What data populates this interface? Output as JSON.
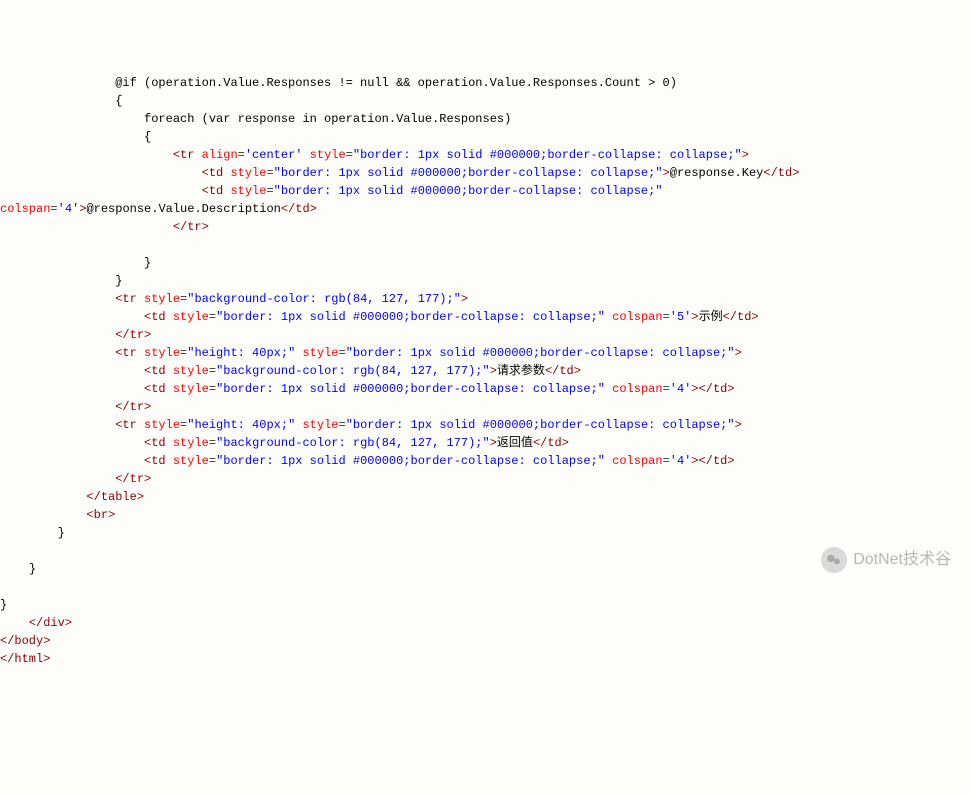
{
  "lines": [
    {
      "indent": "                ",
      "parts": [
        {
          "t": "@if (operation.Value.Responses != null && operation.Value.Responses.Count > 0)",
          "c": "razor"
        }
      ]
    },
    {
      "indent": "                ",
      "parts": [
        {
          "t": "{",
          "c": "razor"
        }
      ]
    },
    {
      "indent": "                    ",
      "parts": [
        {
          "t": "foreach (var response in operation.Value.Responses)",
          "c": "razor"
        }
      ]
    },
    {
      "indent": "                    ",
      "parts": [
        {
          "t": "{",
          "c": "razor"
        }
      ]
    },
    {
      "indent": "                        ",
      "parts": [
        {
          "t": "<",
          "c": "tag"
        },
        {
          "t": "tr",
          "c": "tag"
        },
        {
          "t": " ",
          "c": ""
        },
        {
          "t": "align",
          "c": "attr-name"
        },
        {
          "t": "=",
          "c": ""
        },
        {
          "t": "'center'",
          "c": "attr-value"
        },
        {
          "t": " ",
          "c": ""
        },
        {
          "t": "style",
          "c": "attr-name"
        },
        {
          "t": "=",
          "c": ""
        },
        {
          "t": "\"border: 1px solid #000000;border-collapse: collapse;\"",
          "c": "attr-value"
        },
        {
          "t": ">",
          "c": "tag"
        }
      ]
    },
    {
      "indent": "                            ",
      "parts": [
        {
          "t": "<",
          "c": "tag"
        },
        {
          "t": "td",
          "c": "tag"
        },
        {
          "t": " ",
          "c": ""
        },
        {
          "t": "style",
          "c": "attr-name"
        },
        {
          "t": "=",
          "c": ""
        },
        {
          "t": "\"border: 1px solid #000000;border-collapse: collapse;\"",
          "c": "attr-value"
        },
        {
          "t": ">",
          "c": "tag"
        },
        {
          "t": "@response.Key",
          "c": "razor"
        },
        {
          "t": "</",
          "c": "tag"
        },
        {
          "t": "td",
          "c": "tag"
        },
        {
          "t": ">",
          "c": "tag"
        }
      ]
    },
    {
      "indent": "                            ",
      "parts": [
        {
          "t": "<",
          "c": "tag"
        },
        {
          "t": "td",
          "c": "tag"
        },
        {
          "t": " ",
          "c": ""
        },
        {
          "t": "style",
          "c": "attr-name"
        },
        {
          "t": "=",
          "c": ""
        },
        {
          "t": "\"border: 1px solid #000000;border-collapse: collapse;\"",
          "c": "attr-value"
        },
        {
          "t": " ",
          "c": ""
        }
      ]
    },
    {
      "indent": "",
      "parts": [
        {
          "t": "colspan",
          "c": "attr-name"
        },
        {
          "t": "=",
          "c": ""
        },
        {
          "t": "'4'",
          "c": "attr-value"
        },
        {
          "t": ">",
          "c": "tag"
        },
        {
          "t": "@response.Value.Description",
          "c": "razor"
        },
        {
          "t": "</",
          "c": "tag"
        },
        {
          "t": "td",
          "c": "tag"
        },
        {
          "t": ">",
          "c": "tag"
        }
      ]
    },
    {
      "indent": "                        ",
      "parts": [
        {
          "t": "</",
          "c": "tag"
        },
        {
          "t": "tr",
          "c": "tag"
        },
        {
          "t": ">",
          "c": "tag"
        }
      ]
    },
    {
      "indent": "",
      "parts": []
    },
    {
      "indent": "                    ",
      "parts": [
        {
          "t": "}",
          "c": "razor"
        }
      ]
    },
    {
      "indent": "                ",
      "parts": [
        {
          "t": "}",
          "c": "razor"
        }
      ]
    },
    {
      "indent": "                ",
      "parts": [
        {
          "t": "<",
          "c": "tag"
        },
        {
          "t": "tr",
          "c": "tag"
        },
        {
          "t": " ",
          "c": ""
        },
        {
          "t": "style",
          "c": "attr-name"
        },
        {
          "t": "=",
          "c": ""
        },
        {
          "t": "\"background-color: rgb(84, 127, 177);\"",
          "c": "attr-value"
        },
        {
          "t": ">",
          "c": "tag"
        }
      ]
    },
    {
      "indent": "                    ",
      "parts": [
        {
          "t": "<",
          "c": "tag"
        },
        {
          "t": "td",
          "c": "tag"
        },
        {
          "t": " ",
          "c": ""
        },
        {
          "t": "style",
          "c": "attr-name"
        },
        {
          "t": "=",
          "c": ""
        },
        {
          "t": "\"border: 1px solid #000000;border-collapse: collapse;\"",
          "c": "attr-value"
        },
        {
          "t": " ",
          "c": ""
        },
        {
          "t": "colspan",
          "c": "attr-name"
        },
        {
          "t": "=",
          "c": ""
        },
        {
          "t": "'5'",
          "c": "attr-value"
        },
        {
          "t": ">",
          "c": "tag"
        },
        {
          "t": "示例",
          "c": "text-content"
        },
        {
          "t": "</",
          "c": "tag"
        },
        {
          "t": "td",
          "c": "tag"
        },
        {
          "t": ">",
          "c": "tag"
        }
      ]
    },
    {
      "indent": "                ",
      "parts": [
        {
          "t": "</",
          "c": "tag"
        },
        {
          "t": "tr",
          "c": "tag"
        },
        {
          "t": ">",
          "c": "tag"
        }
      ]
    },
    {
      "indent": "                ",
      "parts": [
        {
          "t": "<",
          "c": "tag"
        },
        {
          "t": "tr",
          "c": "tag"
        },
        {
          "t": " ",
          "c": ""
        },
        {
          "t": "style",
          "c": "attr-name"
        },
        {
          "t": "=",
          "c": ""
        },
        {
          "t": "\"height: 40px;\"",
          "c": "attr-value"
        },
        {
          "t": " ",
          "c": ""
        },
        {
          "t": "style",
          "c": "attr-name"
        },
        {
          "t": "=",
          "c": ""
        },
        {
          "t": "\"border: 1px solid #000000;border-collapse: collapse;\"",
          "c": "attr-value"
        },
        {
          "t": ">",
          "c": "tag"
        }
      ]
    },
    {
      "indent": "                    ",
      "parts": [
        {
          "t": "<",
          "c": "tag"
        },
        {
          "t": "td",
          "c": "tag"
        },
        {
          "t": " ",
          "c": ""
        },
        {
          "t": "style",
          "c": "attr-name"
        },
        {
          "t": "=",
          "c": ""
        },
        {
          "t": "\"background-color: rgb(84, 127, 177);\"",
          "c": "attr-value"
        },
        {
          "t": ">",
          "c": "tag"
        },
        {
          "t": "请求参数",
          "c": "text-content"
        },
        {
          "t": "</",
          "c": "tag"
        },
        {
          "t": "td",
          "c": "tag"
        },
        {
          "t": ">",
          "c": "tag"
        }
      ]
    },
    {
      "indent": "                    ",
      "parts": [
        {
          "t": "<",
          "c": "tag"
        },
        {
          "t": "td",
          "c": "tag"
        },
        {
          "t": " ",
          "c": ""
        },
        {
          "t": "style",
          "c": "attr-name"
        },
        {
          "t": "=",
          "c": ""
        },
        {
          "t": "\"border: 1px solid #000000;border-collapse: collapse;\"",
          "c": "attr-value"
        },
        {
          "t": " ",
          "c": ""
        },
        {
          "t": "colspan",
          "c": "attr-name"
        },
        {
          "t": "=",
          "c": ""
        },
        {
          "t": "'4'",
          "c": "attr-value"
        },
        {
          "t": "></",
          "c": "tag"
        },
        {
          "t": "td",
          "c": "tag"
        },
        {
          "t": ">",
          "c": "tag"
        }
      ]
    },
    {
      "indent": "                ",
      "parts": [
        {
          "t": "</",
          "c": "tag"
        },
        {
          "t": "tr",
          "c": "tag"
        },
        {
          "t": ">",
          "c": "tag"
        }
      ]
    },
    {
      "indent": "                ",
      "parts": [
        {
          "t": "<",
          "c": "tag"
        },
        {
          "t": "tr",
          "c": "tag"
        },
        {
          "t": " ",
          "c": ""
        },
        {
          "t": "style",
          "c": "attr-name"
        },
        {
          "t": "=",
          "c": ""
        },
        {
          "t": "\"height: 40px;\"",
          "c": "attr-value"
        },
        {
          "t": " ",
          "c": ""
        },
        {
          "t": "style",
          "c": "attr-name"
        },
        {
          "t": "=",
          "c": ""
        },
        {
          "t": "\"border: 1px solid #000000;border-collapse: collapse;\"",
          "c": "attr-value"
        },
        {
          "t": ">",
          "c": "tag"
        }
      ]
    },
    {
      "indent": "                    ",
      "parts": [
        {
          "t": "<",
          "c": "tag"
        },
        {
          "t": "td",
          "c": "tag"
        },
        {
          "t": " ",
          "c": ""
        },
        {
          "t": "style",
          "c": "attr-name"
        },
        {
          "t": "=",
          "c": ""
        },
        {
          "t": "\"background-color: rgb(84, 127, 177);\"",
          "c": "attr-value"
        },
        {
          "t": ">",
          "c": "tag"
        },
        {
          "t": "返回值",
          "c": "text-content"
        },
        {
          "t": "</",
          "c": "tag"
        },
        {
          "t": "td",
          "c": "tag"
        },
        {
          "t": ">",
          "c": "tag"
        }
      ]
    },
    {
      "indent": "                    ",
      "parts": [
        {
          "t": "<",
          "c": "tag"
        },
        {
          "t": "td",
          "c": "tag"
        },
        {
          "t": " ",
          "c": ""
        },
        {
          "t": "style",
          "c": "attr-name"
        },
        {
          "t": "=",
          "c": ""
        },
        {
          "t": "\"border: 1px solid #000000;border-collapse: collapse;\"",
          "c": "attr-value"
        },
        {
          "t": " ",
          "c": ""
        },
        {
          "t": "colspan",
          "c": "attr-name"
        },
        {
          "t": "=",
          "c": ""
        },
        {
          "t": "'4'",
          "c": "attr-value"
        },
        {
          "t": "></",
          "c": "tag"
        },
        {
          "t": "td",
          "c": "tag"
        },
        {
          "t": ">",
          "c": "tag"
        }
      ]
    },
    {
      "indent": "                ",
      "parts": [
        {
          "t": "</",
          "c": "tag"
        },
        {
          "t": "tr",
          "c": "tag"
        },
        {
          "t": ">",
          "c": "tag"
        }
      ]
    },
    {
      "indent": "            ",
      "parts": [
        {
          "t": "</",
          "c": "tag"
        },
        {
          "t": "table",
          "c": "tag"
        },
        {
          "t": ">",
          "c": "tag"
        }
      ]
    },
    {
      "indent": "            ",
      "parts": [
        {
          "t": "<",
          "c": "tag"
        },
        {
          "t": "br",
          "c": "tag"
        },
        {
          "t": ">",
          "c": "tag"
        }
      ]
    },
    {
      "indent": "        ",
      "parts": [
        {
          "t": "}",
          "c": "razor"
        }
      ]
    },
    {
      "indent": "",
      "parts": []
    },
    {
      "indent": "    ",
      "parts": [
        {
          "t": "}",
          "c": "razor"
        }
      ]
    },
    {
      "indent": "",
      "parts": []
    },
    {
      "indent": "",
      "parts": [
        {
          "t": "}",
          "c": "razor"
        }
      ]
    },
    {
      "indent": "    ",
      "parts": [
        {
          "t": "</",
          "c": "tag"
        },
        {
          "t": "div",
          "c": "tag"
        },
        {
          "t": ">",
          "c": "tag"
        }
      ]
    },
    {
      "indent": "",
      "parts": [
        {
          "t": "</",
          "c": "tag"
        },
        {
          "t": "body",
          "c": "tag"
        },
        {
          "t": ">",
          "c": "tag"
        }
      ]
    },
    {
      "indent": "",
      "parts": [
        {
          "t": "</",
          "c": "tag"
        },
        {
          "t": "html",
          "c": "tag"
        },
        {
          "t": ">",
          "c": "tag"
        }
      ]
    }
  ],
  "watermark": {
    "text": "DotNet技术谷"
  }
}
